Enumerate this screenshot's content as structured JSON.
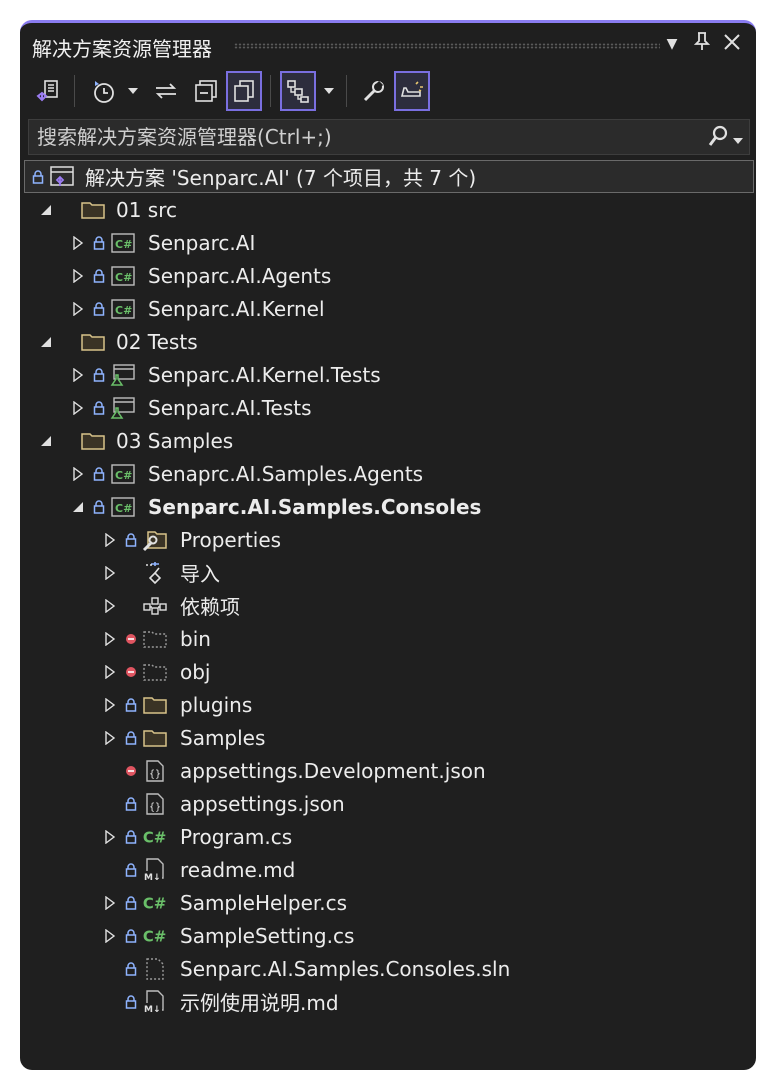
{
  "window": {
    "title": "解决方案资源管理器",
    "pin_label": "pin",
    "close_label": "close"
  },
  "toolbar": {
    "items": [
      "vs-solution-icon",
      "history-icon",
      "sync-icon",
      "collapse-all-icon",
      "show-all-files-icon",
      "tree-view-icon",
      "properties-icon",
      "preview-icon"
    ]
  },
  "search": {
    "placeholder": "搜索解决方案资源管理器(Ctrl+;)"
  },
  "tree": {
    "solution": "解决方案 'Senparc.AI' (7 个项目，共 7 个)",
    "folder_src": "01 src",
    "proj_ai": "Senparc.AI",
    "proj_agents": "Senparc.AI.Agents",
    "proj_kernel": "Senparc.AI.Kernel",
    "folder_tests": "02 Tests",
    "proj_kernel_tests": "Senparc.AI.Kernel.Tests",
    "proj_tests": "Senparc.AI.Tests",
    "folder_samples": "03 Samples",
    "proj_samples_agents": "Senaprc.AI.Samples.Agents",
    "proj_samples_consoles": "Senparc.AI.Samples.Consoles",
    "item_properties": "Properties",
    "item_imports": "导入",
    "item_deps": "依赖项",
    "item_bin": "bin",
    "item_obj": "obj",
    "item_plugins": "plugins",
    "item_samples": "Samples",
    "item_appsettings_dev": "appsettings.Development.json",
    "item_appsettings": "appsettings.json",
    "item_program": "Program.cs",
    "item_readme": "readme.md",
    "item_samplehelper": "SampleHelper.cs",
    "item_samplesetting": "SampleSetting.cs",
    "item_sln": "Senparc.AI.Samples.Consoles.sln",
    "item_usage_md": "示例使用说明.md"
  },
  "colors": {
    "background": "#1f1f1f",
    "accent": "#8a7cf0",
    "lock": "#8fb4ff",
    "excluded": "#e05561",
    "folder": "#d8c38a",
    "csharp": "#6abf69"
  }
}
